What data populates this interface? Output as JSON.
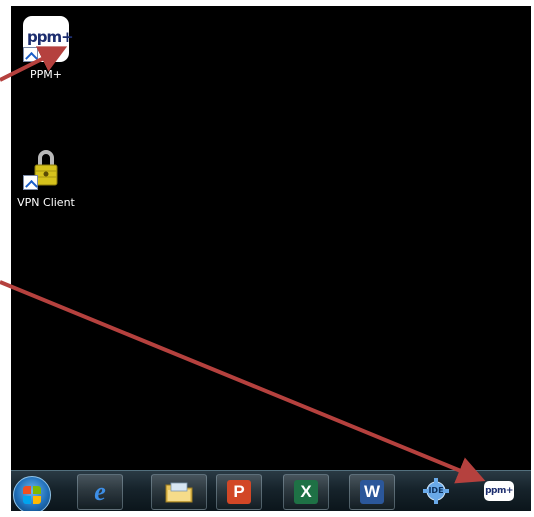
{
  "desktop": {
    "icons": [
      {
        "label": "PPM+",
        "tile_text": "ppm+"
      },
      {
        "label": "VPN Client"
      }
    ]
  },
  "taskbar": {
    "pinned": [
      {
        "name": "start",
        "icon": "windows-flag-icon"
      },
      {
        "name": "internet-explorer",
        "glyph": "e",
        "icon": "ie-icon"
      },
      {
        "name": "file-explorer",
        "icon": "folder-icon"
      },
      {
        "name": "powerpoint",
        "glyph": "P",
        "icon": "powerpoint-icon"
      },
      {
        "name": "excel",
        "glyph": "X",
        "icon": "excel-icon"
      },
      {
        "name": "word",
        "glyph": "W",
        "icon": "word-icon"
      },
      {
        "name": "ide",
        "glyph": "IDE",
        "icon": "ide-gear-icon"
      },
      {
        "name": "ppm-plus",
        "glyph": "ppm+",
        "icon": "ppm-plus-icon"
      }
    ]
  },
  "colors": {
    "desktop_bg": "#000000",
    "annotation_arrow": "#b5413e",
    "ppm_brand": "#1c2d6e",
    "powerpoint": "#d24726",
    "excel": "#1e7145",
    "word": "#2b579a"
  }
}
